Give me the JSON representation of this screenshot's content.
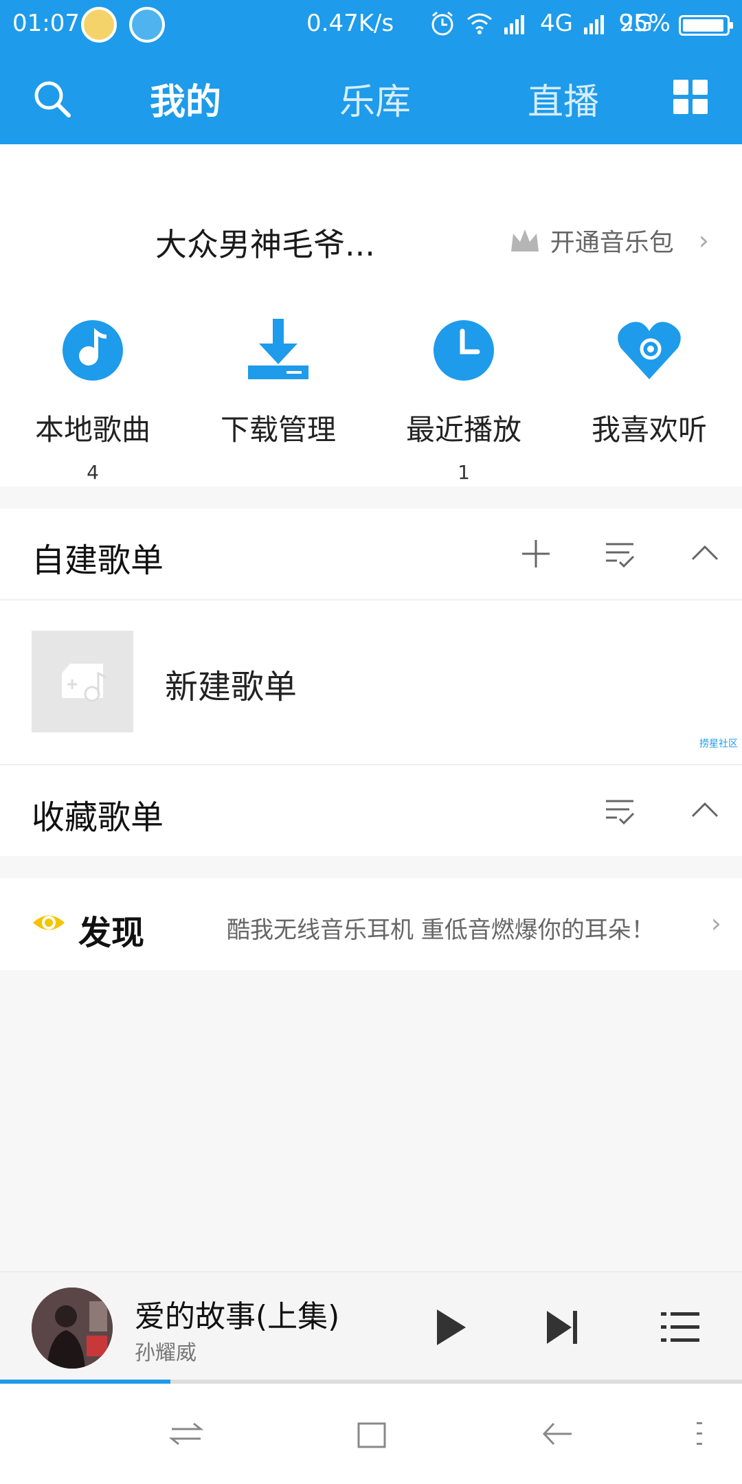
{
  "status_bar": {
    "time": "01:07",
    "net_speed": "0.47K/s",
    "net1": "4G",
    "net2": "2G",
    "battery_pct": "95%",
    "battery_level": 0.95,
    "icons": [
      "alarm-icon",
      "wifi-icon",
      "signal-icon"
    ]
  },
  "nav": {
    "tabs": [
      {
        "label": "我的",
        "active": true
      },
      {
        "label": "乐库",
        "active": false
      },
      {
        "label": "直播",
        "active": false
      }
    ]
  },
  "profile": {
    "username": "大众男神毛爷...",
    "vip_label": "开通音乐包",
    "vip_chevron": "›"
  },
  "quick_actions": [
    {
      "label": "本地歌曲",
      "count": "4",
      "icon": "local-music-icon"
    },
    {
      "label": "下载管理",
      "count": "",
      "icon": "download-icon"
    },
    {
      "label": "最近播放",
      "count": "1",
      "icon": "clock-icon"
    },
    {
      "label": "我喜欢听",
      "count": "",
      "icon": "heart-icon"
    }
  ],
  "custom_playlists": {
    "title": "自建歌单",
    "new_label": "新建歌单",
    "watermark": "捞星社区"
  },
  "collected_playlists": {
    "title": "收藏歌单"
  },
  "discover": {
    "label": "发现",
    "text": "酷我无线音乐耳机 重低音燃爆你的耳朵！",
    "chevron": "›"
  },
  "player": {
    "title": "爱的故事(上集)",
    "artist": "孙耀威",
    "progress": 0.23
  },
  "colors": {
    "brand": "#1e9bea",
    "discover_eye": "#f5c400"
  }
}
